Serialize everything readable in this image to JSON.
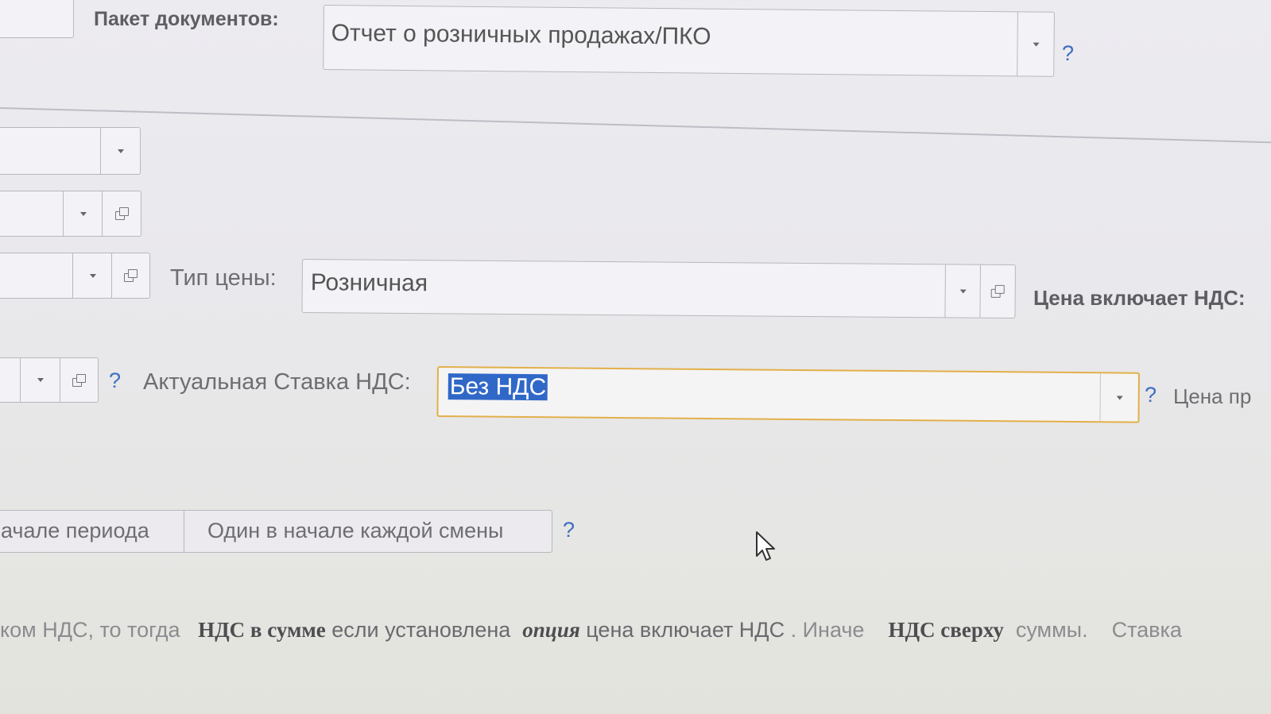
{
  "package": {
    "label": "Пакет документов:",
    "value": "Отчет о розничных продажах/ПКО",
    "help": "?"
  },
  "price_type": {
    "label": "Тип цены:",
    "value": "Розничная"
  },
  "price_includes_vat": {
    "label": "Цена включает НДС:"
  },
  "vat_rate": {
    "help_before": "?",
    "label": "Актуальная Ставка НДС:",
    "value": "Без НДС",
    "help_after": "?",
    "trailing_label": "Цена пр"
  },
  "period_toggle": {
    "left_label": "ачале периода",
    "right_label": "Один в начале каждой смены",
    "help": "?"
  },
  "note": {
    "part1": "ком НДС, то тогда",
    "part2": "НДС в сумме",
    "part3": "если установлена",
    "part4": "опция",
    "part5": "цена включает НДС",
    "part6": ". Иначе",
    "part7": "НДС сверху",
    "part8": "суммы.",
    "part9": "Ставка"
  },
  "colors": {
    "accent_help": "#3f6fc0",
    "focus_border": "#e2b04a",
    "selection": "#3068c8"
  }
}
